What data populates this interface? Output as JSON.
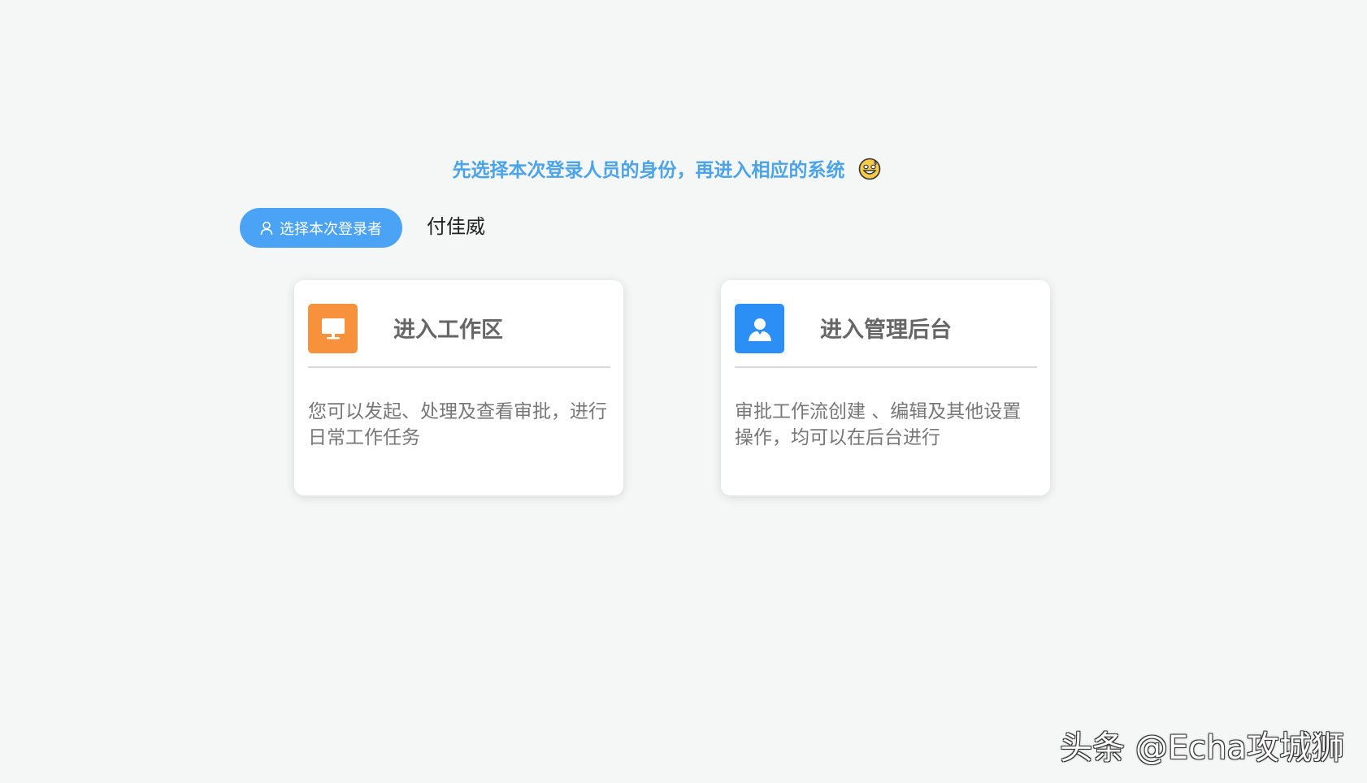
{
  "headline": {
    "text": "先选择本次登录人员的身份，再进入相应的系统"
  },
  "login_selector": {
    "button_label": "选择本次登录者",
    "selected_person": "付佳威"
  },
  "cards": [
    {
      "title": "进入工作区",
      "description": "您可以发起、处理及查看审批，进行日常工作任务",
      "icon": "monitor-icon",
      "icon_color": "#f8913c"
    },
    {
      "title": "进入管理后台",
      "description": "审批工作流创建 、编辑及其他设置操作，均可以在后台进行",
      "icon": "user-icon",
      "icon_color": "#2b8ff5"
    }
  ],
  "watermark": {
    "text": "头条 @Echa攻城狮"
  },
  "colors": {
    "accent": "#4ba3ea",
    "button": "#4ba3f5",
    "background": "#f5f6f6"
  }
}
